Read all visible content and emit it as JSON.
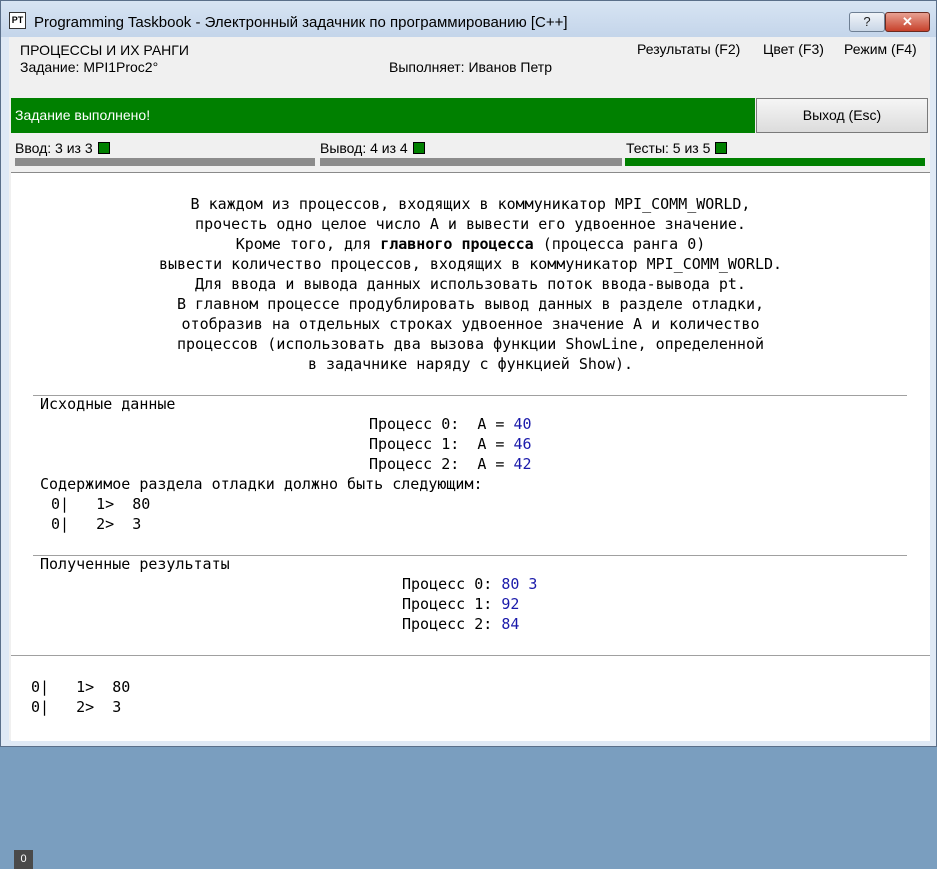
{
  "window": {
    "title": "Programming Taskbook - Электронный задачник по программированию [C++]",
    "icon_text": "PT",
    "help_label": "?",
    "close_label": "✕"
  },
  "header": {
    "group": "ПРОЦЕССЫ И ИХ РАНГИ",
    "task": "Задание: MPI1Proc2°",
    "performer": "Выполняет: Иванов Петр",
    "menu": [
      "Результаты (F2)",
      "Цвет (F3)",
      "Режим (F4)"
    ]
  },
  "status": {
    "message": "Задание выполнено!",
    "exit_label": "Выход (Esc)",
    "color": "#008000"
  },
  "counters": [
    {
      "label": "Ввод: 3 из 3",
      "fraction": 0
    },
    {
      "label": "Вывод: 4 из 4",
      "fraction": 0
    },
    {
      "label": "Тесты: 5 из 5",
      "fraction": 1
    }
  ],
  "description": {
    "line1": "В каждом из процессов, входящих в коммуникатор MPI_COMM_WORLD,",
    "line2": "прочесть одно целое число A и вывести его удвоенное значение.",
    "line3_pre": "Кроме того, для ",
    "line3_bold": "главного процесса",
    "line3_post": " (процесса ранга 0)",
    "line4": "вывести количество процессов, входящих в коммуникатор MPI_COMM_WORLD.",
    "line5": "Для ввода и вывода данных использовать поток ввода-вывода pt.",
    "line6": "В главном процессе продублировать вывод данных в разделе отладки,",
    "line7": "отобразив на отдельных строках удвоенное значение A и количество",
    "line8": "процессов (использовать два вызова функции ShowLine, определенной",
    "line9": "в задачнике наряду с функцией Show)."
  },
  "input": {
    "heading": "Исходные данные",
    "rows": [
      {
        "label": "Процесс 0:  A = ",
        "value": "40"
      },
      {
        "label": "Процесс 1:  A = ",
        "value": "46"
      },
      {
        "label": "Процесс 2:  A = ",
        "value": "42"
      }
    ],
    "debug_heading": "Содержимое раздела отладки должно быть следующим:",
    "debug_lines": [
      "0|   1>  80",
      "0|   2>  3"
    ]
  },
  "results": {
    "heading": "Полученные результаты",
    "rows": [
      {
        "label": "Процесс 0: ",
        "value": "80 3"
      },
      {
        "label": "Процесс 1: ",
        "value": "92"
      },
      {
        "label": "Процесс 2: ",
        "value": "84"
      }
    ]
  },
  "debug_output": {
    "lines": [
      "0|   1>  80",
      "0|   2>  3"
    ],
    "corner": "0"
  }
}
